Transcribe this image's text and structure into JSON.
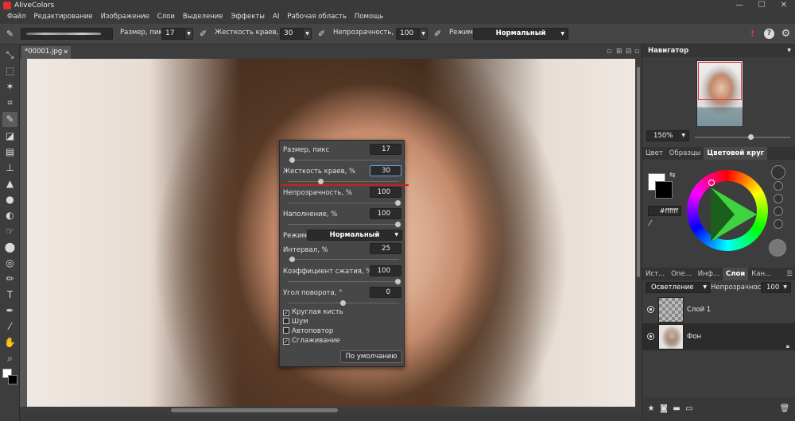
{
  "app": {
    "title": "AliveColors",
    "win_min": "—",
    "win_max": "☐",
    "win_close": "✕"
  },
  "menu": [
    "Файл",
    "Редактирование",
    "Изображение",
    "Слои",
    "Выделение",
    "Эффекты",
    "AI",
    "Рабочая область",
    "Помощь"
  ],
  "options": {
    "size_label": "Размер, пикс",
    "size_value": "17",
    "hardness_label": "Жесткость краев, %",
    "hardness_value": "30",
    "opacity_label": "Непрозрачность, %",
    "opacity_value": "100",
    "mode_label": "Режим:",
    "mode_value": "Нормальный"
  },
  "document": {
    "tab": "*00001.jpg"
  },
  "popup": {
    "size_label": "Размер, пикс",
    "size_value": "17",
    "hardness_label": "Жесткость краев, %",
    "hardness_value": "30",
    "opacity_label": "Непрозрачность, %",
    "opacity_value": "100",
    "fill_label": "Наполнение, %",
    "fill_value": "100",
    "mode_label": "Режим:",
    "mode_value": "Нормальный",
    "interval_label": "Интервал, %",
    "interval_value": "25",
    "compress_label": "Коэффициент сжатия, %",
    "compress_value": "100",
    "angle_label": "Угол поворота, °",
    "angle_value": "0",
    "round_brush": "Круглая кисть",
    "noise": "Шум",
    "autorepeat": "Автоповтор",
    "smoothing": "Сглаживание",
    "round_brush_checked": true,
    "noise_checked": false,
    "autorepeat_checked": false,
    "smoothing_checked": true,
    "default_button": "По умолчанию"
  },
  "navigator": {
    "title": "Навигатор",
    "zoom": "150%"
  },
  "color_tabs": [
    "Цвет",
    "Образцы",
    "Цветовой круг"
  ],
  "color": {
    "hex": "#ffffff",
    "fg": "#ffffff",
    "bg": "#000000"
  },
  "layer_tabs": [
    "Ист...",
    "Опе...",
    "Инф...",
    "Слои",
    "Кан..."
  ],
  "layers": {
    "blend": "Осветление",
    "opacity_label": "Непрозрачность",
    "opacity_value": "100",
    "items": [
      {
        "name": "Слой 1"
      },
      {
        "name": "Фон"
      }
    ]
  },
  "icons": {
    "alert": "alert-icon",
    "help": "help-icon",
    "settings": "gear-icon"
  }
}
